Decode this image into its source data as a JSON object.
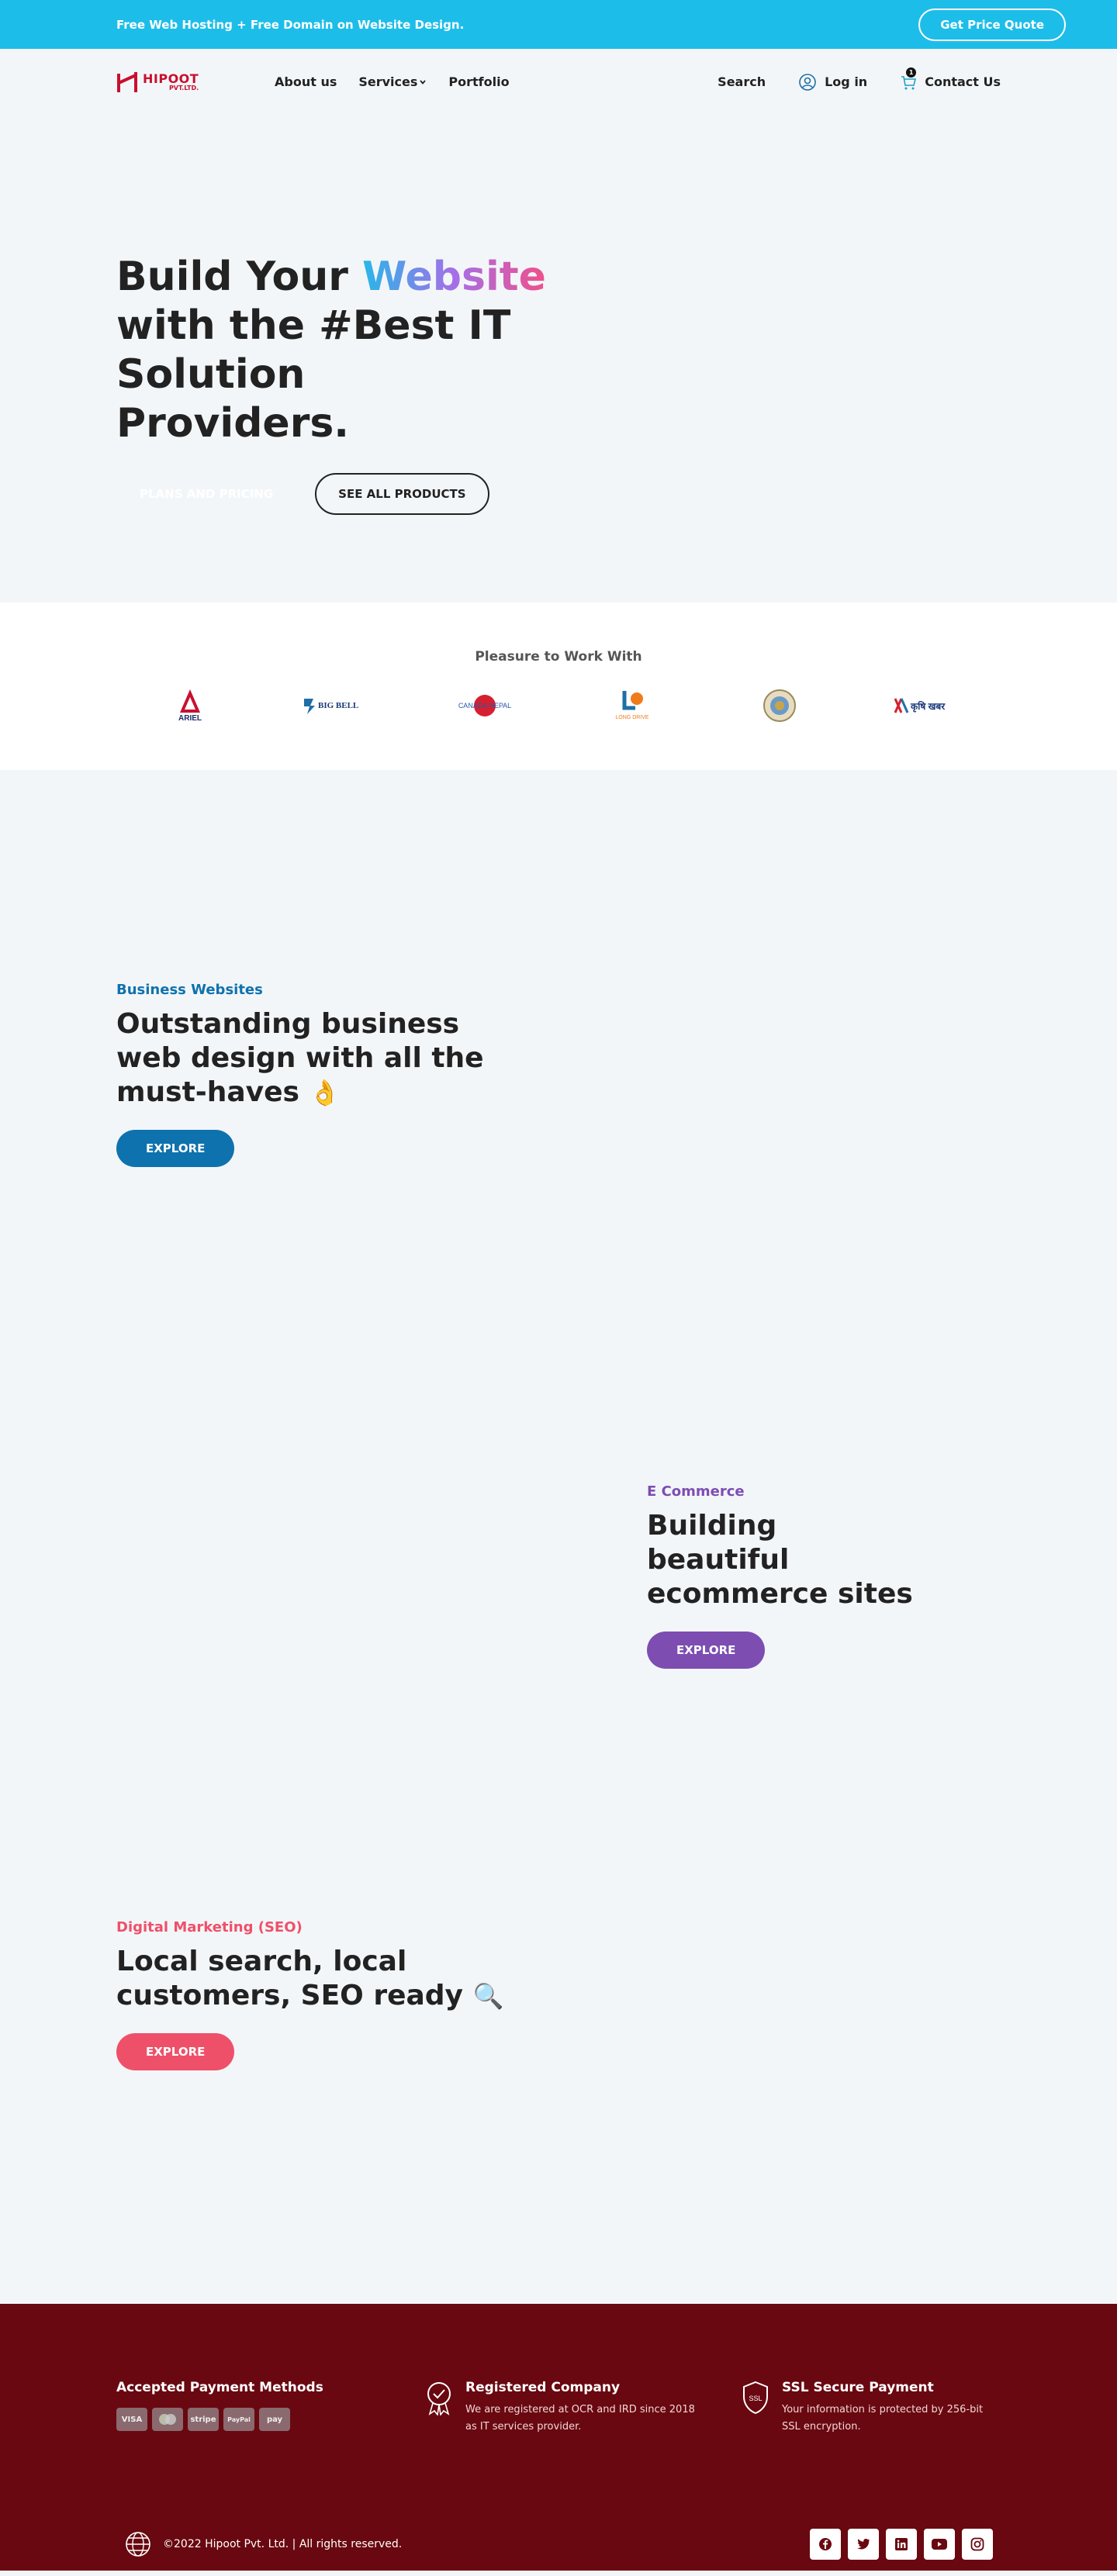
{
  "topbar": {
    "promo": "Free Web Hosting + Free Domain on Website Design.",
    "quote_button": "Get Price Quote"
  },
  "nav": {
    "logo_name": "HIPOOT",
    "logo_sub": "PVT.LTD.",
    "links": [
      "About us",
      "Services",
      "Portfolio"
    ],
    "search": "Search",
    "login": "Log in",
    "cart_count": "1",
    "contact": "Contact Us"
  },
  "hero": {
    "title_pre": "Build Your ",
    "title_highlight": "Website",
    "title_post": " with the #Best IT Solution Providers.",
    "btn_plans": "PLANS AND PRICING",
    "btn_products": "SEE ALL PRODUCTS"
  },
  "partners": {
    "title": "Pleasure to Work With",
    "logos": [
      "ARIEL",
      "BIG BELL",
      "CANADA NEPAL",
      "LONG DRIVE",
      "",
      "कृषि खबर"
    ]
  },
  "features": [
    {
      "tag": "Business Websites",
      "title": "Outstanding business web design with all the must-haves",
      "emoji": "👌",
      "button": "EXPLORE",
      "color": "#0e72ae"
    },
    {
      "tag": "E Commerce",
      "title": "Building beautiful ecommerce sites",
      "emoji": "",
      "button": "EXPLORE",
      "color": "#7d4db2"
    },
    {
      "tag": "Digital Marketing (SEO)",
      "title": "Local search, local customers, SEO ready",
      "emoji": "🔍",
      "button": "EXPLORE",
      "color": "#ef5069"
    }
  ],
  "footer": {
    "payment_title": "Accepted Payment Methods",
    "payments": [
      "VISA",
      "MC",
      "stripe",
      "PayPal",
      "pay"
    ],
    "registered_title": "Registered Company",
    "registered_text": "We are registered at OCR and IRD since 2018 as IT services provider.",
    "ssl_title": "SSL Secure Payment",
    "ssl_text": "Your information is protected by 256-bit SSL encryption.",
    "copyright": "©2022 Hipoot Pvt. Ltd. | All rights reserved.",
    "socials": [
      "facebook-icon",
      "twitter-icon",
      "linkedin-icon",
      "youtube-icon",
      "instagram-icon"
    ]
  }
}
